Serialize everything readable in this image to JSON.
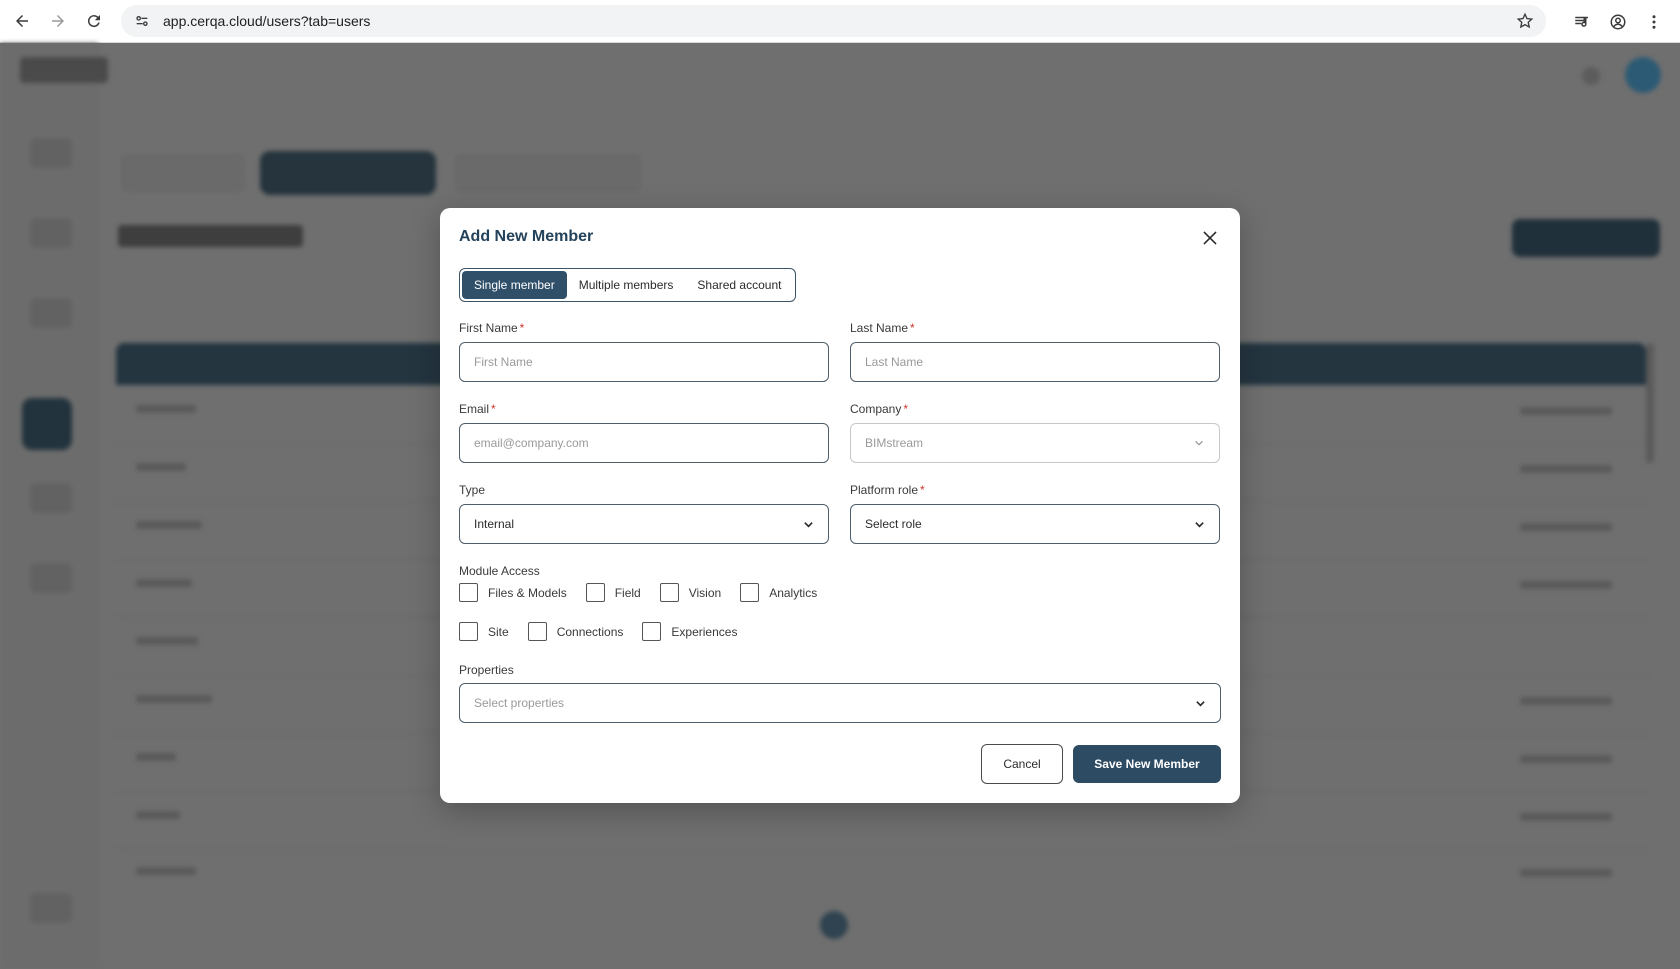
{
  "browser": {
    "url": "app.cerqa.cloud/users?tab=users",
    "icons": [
      "back-icon",
      "forward-icon",
      "reload-icon",
      "site-info-icon",
      "bookmark-star-icon",
      "media-control-icon",
      "profile-icon",
      "more-menu-icon"
    ]
  },
  "modal": {
    "title": "Add New Member",
    "close_icon": "close-icon",
    "tabs": [
      {
        "label": "Single member",
        "active": true
      },
      {
        "label": "Multiple members",
        "active": false
      },
      {
        "label": "Shared account",
        "active": false
      }
    ],
    "first_name": {
      "label": "First Name",
      "required_mark": "*",
      "placeholder": "First Name",
      "value": ""
    },
    "last_name": {
      "label": "Last Name",
      "required_mark": "*",
      "placeholder": "Last Name",
      "value": ""
    },
    "email": {
      "label": "Email",
      "required_mark": "*",
      "placeholder": "email@company.com",
      "value": ""
    },
    "company": {
      "label": "Company",
      "required_mark": "*",
      "value": "BIMstream"
    },
    "type": {
      "label": "Type",
      "value": "Internal"
    },
    "platform_role": {
      "label": "Platform role",
      "required_mark": "*",
      "value": "Select role"
    },
    "module_access": {
      "label": "Module Access",
      "row1": [
        "Files & Models",
        "Field",
        "Vision",
        "Analytics"
      ],
      "row2": [
        "Site",
        "Connections",
        "Experiences"
      ]
    },
    "properties": {
      "label": "Properties",
      "value": "Select properties"
    },
    "cancel_label": "Cancel",
    "save_label": "Save New Member"
  },
  "colors": {
    "primary": "#2d4b63",
    "title": "#24425a",
    "required": "#d0342c",
    "overlay": "#6e6e6e"
  }
}
